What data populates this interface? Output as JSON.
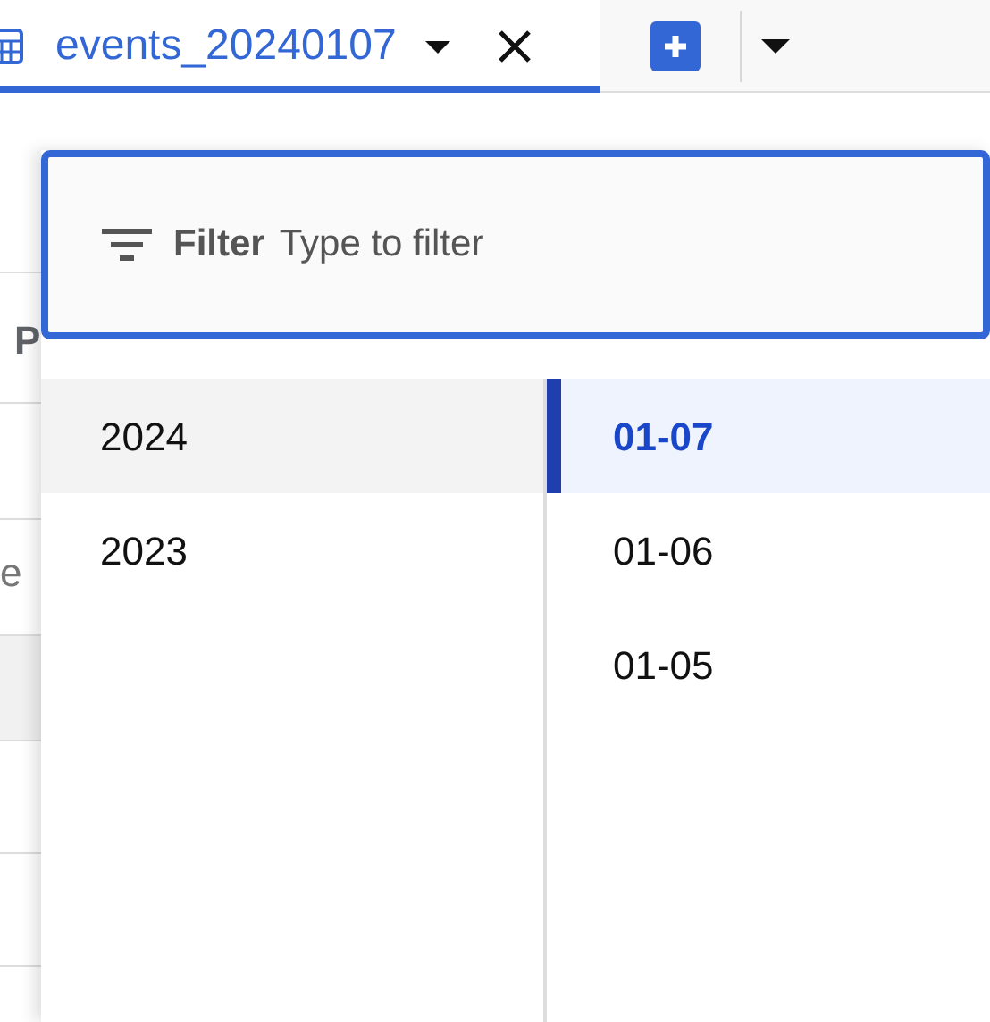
{
  "tabs": [
    {
      "label": "events_20240107",
      "selected": true
    }
  ],
  "background_texts": [
    "P",
    "e"
  ],
  "filter": {
    "label": "Filter",
    "placeholder": "Type to filter"
  },
  "years": [
    {
      "label": "2024",
      "selected": true
    },
    {
      "label": "2023",
      "selected": false
    }
  ],
  "dates": [
    {
      "label": "01-07",
      "selected": true
    },
    {
      "label": "01-06",
      "selected": false
    },
    {
      "label": "01-05",
      "selected": false
    }
  ]
}
